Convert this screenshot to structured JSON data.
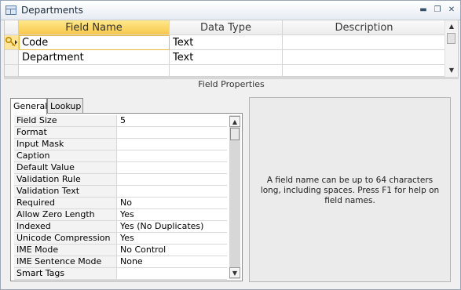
{
  "window": {
    "title": "Departments"
  },
  "grid": {
    "headers": [
      "Field Name",
      "Data Type",
      "Description"
    ],
    "rows": [
      {
        "field": "Code",
        "type": "Text",
        "desc": ""
      },
      {
        "field": "Department",
        "type": "Text",
        "desc": ""
      },
      {
        "field": "",
        "type": "",
        "desc": ""
      }
    ]
  },
  "field_properties_label": "Field Properties",
  "tabs": [
    "General",
    "Lookup"
  ],
  "properties": [
    {
      "name": "Field Size",
      "value": "5"
    },
    {
      "name": "Format",
      "value": ""
    },
    {
      "name": "Input Mask",
      "value": ""
    },
    {
      "name": "Caption",
      "value": ""
    },
    {
      "name": "Default Value",
      "value": ""
    },
    {
      "name": "Validation Rule",
      "value": ""
    },
    {
      "name": "Validation Text",
      "value": ""
    },
    {
      "name": "Required",
      "value": "No"
    },
    {
      "name": "Allow Zero Length",
      "value": "Yes"
    },
    {
      "name": "Indexed",
      "value": "Yes (No Duplicates)"
    },
    {
      "name": "Unicode Compression",
      "value": "Yes"
    },
    {
      "name": "IME Mode",
      "value": "No Control"
    },
    {
      "name": "IME Sentence Mode",
      "value": "None"
    },
    {
      "name": "Smart Tags",
      "value": ""
    }
  ],
  "help_text": "A field name can be up to 64 characters long, including spaces. Press F1 for help on field names.",
  "colors": {
    "header_selected": "#f7c84d",
    "key_icon": "#d9a400"
  }
}
